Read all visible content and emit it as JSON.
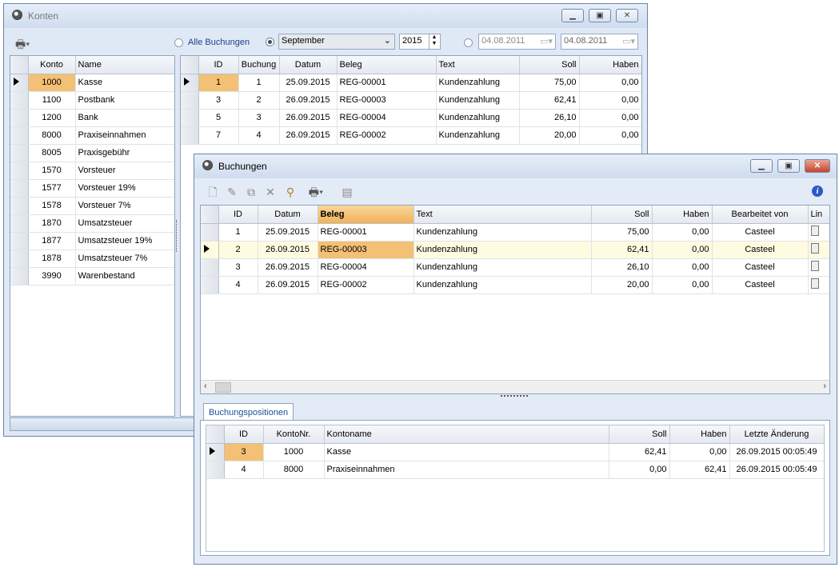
{
  "konten": {
    "title": "Konten",
    "filter": {
      "all_label": "Alle Buchungen",
      "month": "September",
      "year": "2015",
      "date_from": "04.08.2011",
      "date_to": "04.08.2011"
    },
    "accounts_columns": [
      "Konto",
      "Name"
    ],
    "accounts": [
      [
        "1000",
        "Kasse"
      ],
      [
        "1100",
        "Postbank"
      ],
      [
        "1200",
        "Bank"
      ],
      [
        "8000",
        "Praxiseinnahmen"
      ],
      [
        "8005",
        "Praxisgebühr"
      ],
      [
        "1570",
        "Vorsteuer"
      ],
      [
        "1577",
        "Vorsteuer 19%"
      ],
      [
        "1578",
        "Vorsteuer 7%"
      ],
      [
        "1870",
        "Umsatzsteuer"
      ],
      [
        "1877",
        "Umsatzsteuer 19%"
      ],
      [
        "1878",
        "Umsatzsteuer 7%"
      ],
      [
        "3990",
        "Warenbestand"
      ]
    ],
    "bookings_columns": [
      "ID",
      "Buchung",
      "Datum",
      "Beleg",
      "Text",
      "Soll",
      "Haben"
    ],
    "bookings": [
      [
        "1",
        "1",
        "25.09.2015",
        "REG-00001",
        "Kundenzahlung",
        "75,00",
        "0,00"
      ],
      [
        "3",
        "2",
        "26.09.2015",
        "REG-00003",
        "Kundenzahlung",
        "62,41",
        "0,00"
      ],
      [
        "5",
        "3",
        "26.09.2015",
        "REG-00004",
        "Kundenzahlung",
        "26,10",
        "0,00"
      ],
      [
        "7",
        "4",
        "26.09.2015",
        "REG-00002",
        "Kundenzahlung",
        "20,00",
        "0,00"
      ]
    ]
  },
  "buchungen": {
    "title": "Buchungen",
    "columns": [
      "ID",
      "Datum",
      "Beleg",
      "Text",
      "Soll",
      "Haben",
      "Bearbeitet von",
      "Lin"
    ],
    "rows": [
      [
        "1",
        "25.09.2015",
        "REG-00001",
        "Kundenzahlung",
        "75,00",
        "0,00",
        "Casteel"
      ],
      [
        "2",
        "26.09.2015",
        "REG-00003",
        "Kundenzahlung",
        "62,41",
        "0,00",
        "Casteel"
      ],
      [
        "3",
        "26.09.2015",
        "REG-00004",
        "Kundenzahlung",
        "26,10",
        "0,00",
        "Casteel"
      ],
      [
        "4",
        "26.09.2015",
        "REG-00002",
        "Kundenzahlung",
        "20,00",
        "0,00",
        "Casteel"
      ]
    ],
    "tab_label": "Buchungspositionen",
    "pos_columns": [
      "ID",
      "KontoNr.",
      "Kontoname",
      "Soll",
      "Haben",
      "Letzte Änderung"
    ],
    "positions": [
      [
        "3",
        "1000",
        "Kasse",
        "62,41",
        "0,00",
        "26.09.2015 00:05:49"
      ],
      [
        "4",
        "8000",
        "Praxiseinnahmen",
        "0,00",
        "62,41",
        "26.09.2015 00:05:49"
      ]
    ]
  }
}
